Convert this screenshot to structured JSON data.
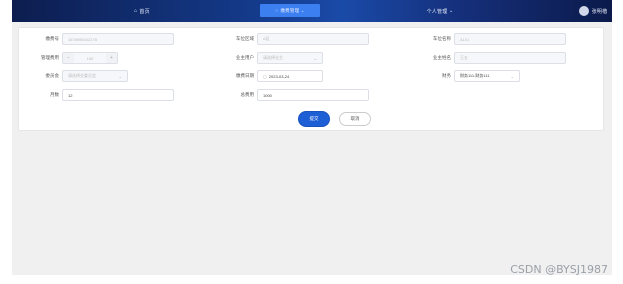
{
  "nav": {
    "home": "首页",
    "management": "缴费管理",
    "personal": "个人管理",
    "user": "张明楷"
  },
  "form": {
    "row1": [
      {
        "label": "缴费号",
        "placeholder": "1678956042278"
      },
      {
        "label": "车位区域",
        "placeholder": "A区"
      },
      {
        "label": "车位名称",
        "placeholder": "A101"
      }
    ],
    "row2": {
      "fee_label": "管理费用",
      "fee_value": "100",
      "owner_account_label": "业主用户",
      "owner_account_placeholder": "请选择业主",
      "owner_name_label": "业主姓名",
      "owner_name_placeholder": "王五"
    },
    "row3": {
      "committee_label": "委员会",
      "committee_placeholder": "请选择业委员会",
      "date_label": "缴费日期",
      "date_value": "2023-03-24",
      "finance_label": "财务",
      "finance_value": "财务111-财务111"
    },
    "row4": {
      "months_label": "月数",
      "months_value": "12",
      "total_label": "总费用",
      "total_value": "1000"
    },
    "submit": "提交",
    "cancel": "取消"
  },
  "watermark": "CSDN @BYSJ1987"
}
